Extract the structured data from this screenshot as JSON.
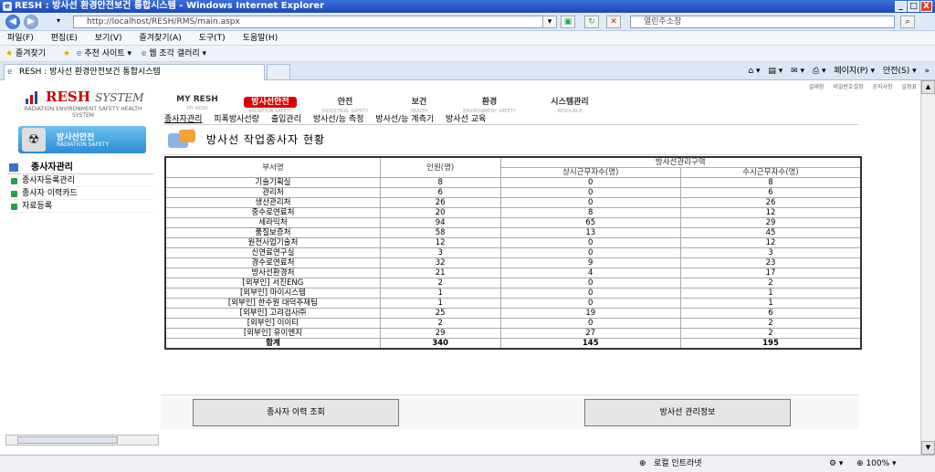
{
  "window": {
    "title": "RESH : 방사선 환경안전보건 통합시스템 - Windows Internet Explorer",
    "min": "_",
    "max": "□",
    "close": "X"
  },
  "address": {
    "url": "http://localhost/RESH/RMS/main.aspx",
    "search_placeholder": "열린주소창"
  },
  "menu": [
    "파일(F)",
    "편집(E)",
    "보기(V)",
    "즐겨찾기(A)",
    "도구(T)",
    "도움말(H)"
  ],
  "favbar": {
    "favorites": "즐겨찾기",
    "suggested": "추천 사이트 ▾",
    "gallery": "웹 조각 갤러리 ▾"
  },
  "tab": {
    "label": "RESH : 방사선 환경안전보건 통합시스템"
  },
  "tabtools": {
    "page": "페이지(P) ▾",
    "safety": "안전(S) ▾",
    "more": "»"
  },
  "app": {
    "logo": {
      "brand": "RESH",
      "system": "SYSTEM",
      "sub": "RADIATION ENVIRONMENT SAFETY HEALTH SYSTEM"
    },
    "util_links": [
      "걸재함",
      "비밀번호설정",
      "공지사항",
      "일정표"
    ],
    "top_menu": [
      {
        "label": "MY RESH",
        "sub": "MY RESH"
      },
      {
        "label": "방사선안전",
        "sub": "RADIATION SAFETY"
      },
      {
        "label": "안전",
        "sub": "INDUSTRIAL SAFETY"
      },
      {
        "label": "보건",
        "sub": "HEALTH"
      },
      {
        "label": "환경",
        "sub": "ENVIRONMENT SAFETY"
      },
      {
        "label": "시스템관리",
        "sub": "RESOURCE"
      }
    ],
    "sub_menu": [
      "종사자관리",
      "피폭방사선량",
      "출입관리",
      "방사선/능 측정",
      "방사선/능 계측기",
      "방사선 교육"
    ],
    "side_badge": {
      "title": "방사선안전",
      "sub": "RADIATION SAFETY"
    },
    "side_head": "종사자관리",
    "side_items": [
      "종사자등록관리",
      "종사자 이력카드",
      "자료등록"
    ],
    "page_title": "방사선 작업종사자 현황",
    "table": {
      "h_dept": "부서명",
      "h_count": "인원(명)",
      "h_zone": "방사선관리구역",
      "h_perm": "상시근무자수(명)",
      "h_temp": "수시근무자수(명)",
      "rows": [
        [
          "기술기획실",
          "8",
          "0",
          "8"
        ],
        [
          "관리처",
          "6",
          "0",
          "6"
        ],
        [
          "생산관리처",
          "26",
          "0",
          "26"
        ],
        [
          "중수로연료처",
          "20",
          "8",
          "12"
        ],
        [
          "세라믹처",
          "94",
          "65",
          "29"
        ],
        [
          "품질보증처",
          "58",
          "13",
          "45"
        ],
        [
          "원전사업기술처",
          "12",
          "0",
          "12"
        ],
        [
          "신연료연구실",
          "3",
          "0",
          "3"
        ],
        [
          "경수로연료처",
          "32",
          "9",
          "23"
        ],
        [
          "방사선환경처",
          "21",
          "4",
          "17"
        ],
        [
          "[외부인] 서진ENG",
          "2",
          "0",
          "2"
        ],
        [
          "[외부인] 마이시스템",
          "1",
          "0",
          "1"
        ],
        [
          "[외부인] 한수원 대덕주재팀",
          "1",
          "0",
          "1"
        ],
        [
          "[외부인] 고려검사㈜",
          "25",
          "19",
          "6"
        ],
        [
          "[외부인] 이이티",
          "2",
          "0",
          "2"
        ],
        [
          "[외부인] 유이엔지",
          "29",
          "27",
          "2"
        ]
      ],
      "total": [
        "합계",
        "340",
        "145",
        "195"
      ]
    },
    "buttons": {
      "history": "종사자 이력 조회",
      "info": "방사선 관리정보"
    }
  },
  "status": {
    "zone": "로컬 인트라넷",
    "zoom": "100%"
  }
}
